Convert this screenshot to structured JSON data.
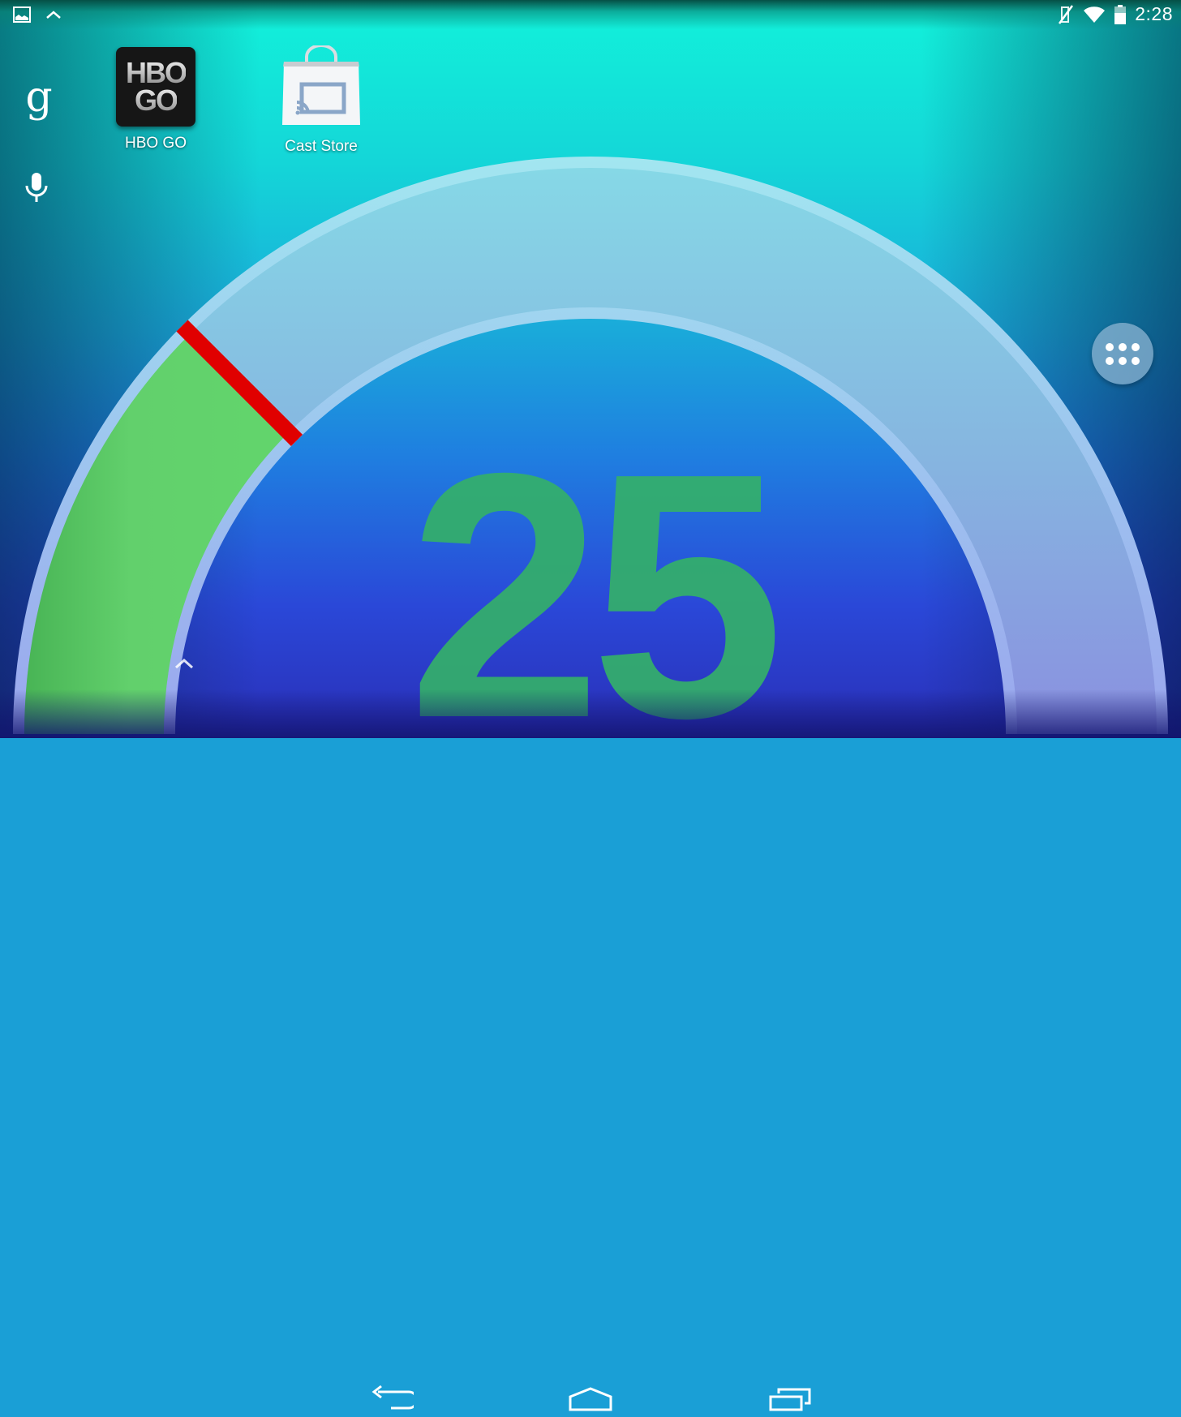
{
  "status_bar": {
    "left_icons": [
      "gallery-notification-icon",
      "chevron-up-icon"
    ],
    "right_icons": [
      "vibrate-mute-icon",
      "wifi-icon",
      "battery-icon"
    ],
    "time": "2:28"
  },
  "search_bar": {
    "google_icon": "g",
    "voice_icon": "mic-icon"
  },
  "apps": [
    {
      "label": "HBO GO",
      "icon": "hbo-go-icon",
      "icon_text_top": "HBO",
      "icon_text_bottom": "GO"
    },
    {
      "label": "Cast Store",
      "icon": "cast-store-icon"
    }
  ],
  "all_apps_button": {
    "icon": "app-drawer-icon"
  },
  "gauge_widget": {
    "value": "25",
    "fill_fraction": 0.25,
    "colors": {
      "fill": "#62d56c",
      "marker": "#e00000",
      "track": "#9fd6ea",
      "number": "#34b06a"
    }
  },
  "nav_bar": {
    "buttons": [
      "back-icon",
      "home-icon",
      "recents-icon"
    ]
  }
}
